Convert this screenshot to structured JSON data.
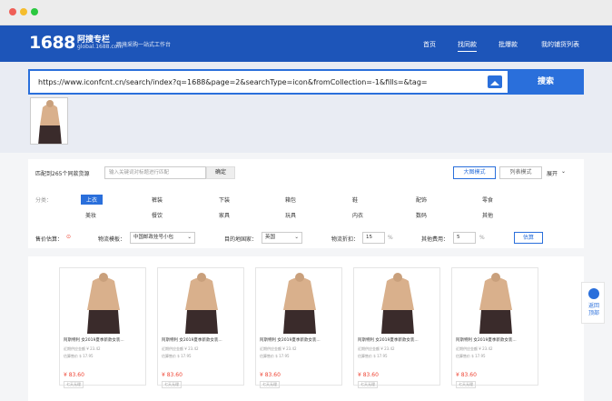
{
  "brand": {
    "logo_num": "1688",
    "logo_cn": "阿搜专栏",
    "logo_sub": "global.1688.com",
    "tagline": "跨境采购一站式工作台"
  },
  "nav": {
    "items": [
      "首页",
      "找同款",
      "批爆款",
      "我的铺货列表"
    ],
    "active_index": 1
  },
  "search": {
    "url": "https://www.iconfcnt.cn/search/index?q=1688&page=2&searchType=icon&fromCollection=-1&fills=&tag=",
    "button": "搜索"
  },
  "filter": {
    "match_text": "匹配到265个同款货源",
    "keyword_placeholder": "输入关键词对标题进行匹配",
    "confirm": "确定",
    "mode_big": "大图模式",
    "mode_list": "列表模式",
    "expand": "展开",
    "category_label": "分类：",
    "categories": [
      "上衣",
      "裤装",
      "下装",
      "箱包",
      "鞋",
      "配饰",
      "零食",
      "美妆",
      "餐饮",
      "家具",
      "玩具",
      "内衣",
      "数码",
      "其他"
    ],
    "selected_category": "上衣",
    "price_label": "售价估算：",
    "template_label": "物流模板：",
    "template_value": "中国邮政挂号小包",
    "dest_label": "目的地国家：",
    "dest_value": "英国",
    "discount_label": "物流折扣：",
    "discount_value": "15",
    "discount_unit": "%",
    "other_label": "其他费用：",
    "other_value": "5",
    "other_unit": "%",
    "calc": "估算"
  },
  "products": [
    {
      "title": "阿斯特利 女2019夏季新款女装...",
      "sold": "近期供应金额 ¥ 23.42",
      "ref": "估算售价 $ 17.95",
      "price": "¥ 83.60",
      "tag": "七天无理"
    },
    {
      "title": "阿斯特利 女2019夏季新款女装...",
      "sold": "近期供应金额 ¥ 23.42",
      "ref": "估算售价 $ 17.95",
      "price": "¥ 83.60",
      "tag": "七天无理"
    },
    {
      "title": "阿斯特利 女2019夏季新款女装...",
      "sold": "近期供应金额 ¥ 23.42",
      "ref": "估算售价 $ 17.95",
      "price": "¥ 83.60",
      "tag": "七天无理"
    },
    {
      "title": "阿斯特利 女2019夏季新款女装...",
      "sold": "近期供应金额 ¥ 23.42",
      "ref": "估算售价 $ 17.95",
      "price": "¥ 83.60",
      "tag": "七天无理"
    },
    {
      "title": "阿斯特利 女2019夏季新款女装...",
      "sold": "近期供应金额 ¥ 23.42",
      "ref": "估算售价 $ 17.95",
      "price": "¥ 83.60",
      "tag": "七天无理"
    }
  ],
  "backtop": {
    "line1": "返回",
    "line2": "顶部"
  },
  "colors": {
    "brand_blue": "#1d55b9",
    "accent_blue": "#2a6fdb",
    "price_red": "#e43"
  }
}
